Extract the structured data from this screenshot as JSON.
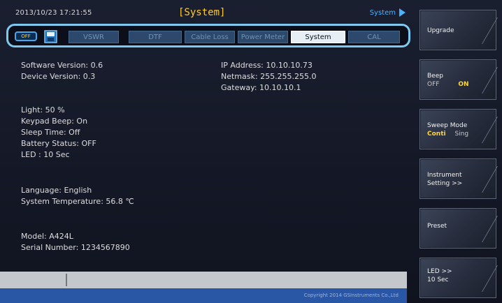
{
  "topbar": {
    "datetime": "2013/10/23 17:21:55",
    "title": "[System]",
    "crumb": "System"
  },
  "tabs": [
    {
      "label": "VSWR",
      "active": false
    },
    {
      "label": "DTF",
      "active": false
    },
    {
      "label": "Cable Loss",
      "active": false
    },
    {
      "label": "Power Meter",
      "active": false
    },
    {
      "label": "System",
      "active": true
    },
    {
      "label": "CAL",
      "active": false
    }
  ],
  "usb_button": "OFF",
  "info": {
    "software_version": "Software Version: 0.6",
    "device_version": "Device Version: 0.3",
    "ip_address": "IP Address: 10.10.10.73",
    "netmask": "Netmask: 255.255.255.0",
    "gateway": "Gateway: 10.10.10.1",
    "light": "Light: 50 %",
    "keypad_beep": "Keypad Beep: On",
    "sleep_time": "Sleep Time: Off",
    "battery_status": "Battery Status: OFF",
    "led": "LED : 10 Sec",
    "language": "Language: English",
    "system_temperature": "System Temperature: 56.8 ℃",
    "model": "Model: A424L",
    "serial_number": "Serial Number: 1234567890"
  },
  "footer": {
    "copyright": "Copyright 2014 GSInstruments Co.,Ltd"
  },
  "softkeys": {
    "upgrade": "Upgrade",
    "beep_label": "Beep",
    "beep_off": "OFF",
    "beep_on": "ON",
    "sweep_label": "Sweep Mode",
    "sweep_conti": "Conti",
    "sweep_sing": "Sing",
    "instrument_line1": "Instrument",
    "instrument_line2": "Setting >>",
    "preset": "Preset",
    "led_line1": "LED >>",
    "led_line2": "10 Sec"
  },
  "colors": {
    "accent_yellow": "#ffcc2a",
    "tab_border": "#7fc8f0",
    "footer_blue": "#2a56a6"
  }
}
